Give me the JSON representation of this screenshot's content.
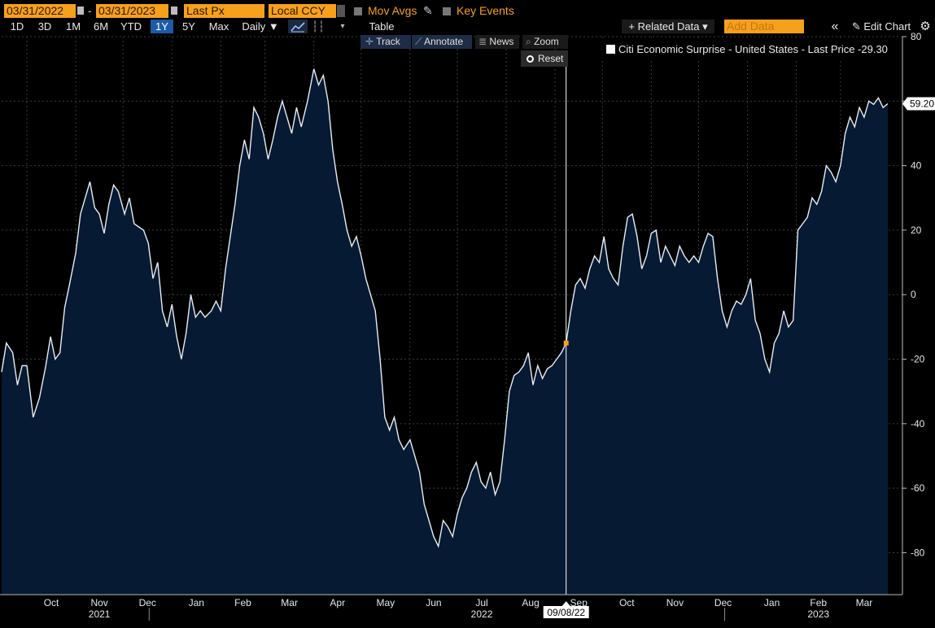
{
  "toolbar": {
    "start_date": "03/31/2022",
    "end_date": "03/31/2023",
    "date_separator": "-",
    "price_field": "Last Px",
    "currency": "Local CCY",
    "mov_avgs": "Mov Avgs",
    "key_events": "Key Events",
    "related_data": "+ Related Data ▾",
    "add_data_placeholder": "Add Data",
    "collapse": "«",
    "edit_chart": "✎ Edit Chart",
    "gear": "⚙"
  },
  "ranges": {
    "buttons": [
      "1D",
      "3D",
      "1M",
      "6M",
      "YTD",
      "1Y",
      "5Y",
      "Max"
    ],
    "active": "1Y",
    "frequency": "Daily ▼",
    "table": "Table"
  },
  "tools": {
    "track": "Track",
    "annotate": "Annotate",
    "news": "News",
    "zoom": "Zoom",
    "reset": "Reset"
  },
  "legend": {
    "label": "Citi Economic Surprise - United States - Last Price -29.30"
  },
  "crosshair": {
    "date_label": "09/08/22",
    "value": -15
  },
  "last_value_label": "59.20",
  "colors": {
    "accent": "#f7a01c",
    "area_fill": "#061a33",
    "line": "#e8eef5",
    "active_button": "#1c5ba8"
  },
  "chart_data": {
    "type": "area",
    "series_label": "Citi Economic Surprise - United States - Last Price",
    "ylim": [
      -93,
      80
    ],
    "y_ticks": [
      80,
      60,
      40,
      20,
      0,
      -20,
      -40,
      -60,
      -80
    ],
    "x_ticks": [
      {
        "label": "Oct",
        "year": ""
      },
      {
        "label": "Nov",
        "year": "2021"
      },
      {
        "label": "Dec",
        "year": ""
      },
      {
        "label": "Jan",
        "year": ""
      },
      {
        "label": "Feb",
        "year": ""
      },
      {
        "label": "Mar",
        "year": ""
      },
      {
        "label": "Apr",
        "year": ""
      },
      {
        "label": "May",
        "year": ""
      },
      {
        "label": "Jun",
        "year": ""
      },
      {
        "label": "Jul",
        "year": "2022"
      },
      {
        "label": "Aug",
        "year": ""
      },
      {
        "label": "Sep",
        "year": ""
      },
      {
        "label": "Oct",
        "year": ""
      },
      {
        "label": "Nov",
        "year": ""
      },
      {
        "label": "Dec",
        "year": ""
      },
      {
        "label": "Jan",
        "year": ""
      },
      {
        "label": "Feb",
        "year": "2023"
      },
      {
        "label": "Mar",
        "year": ""
      }
    ],
    "x_start": "2021-09-15",
    "x_end": "2023-03-31",
    "points": [
      [
        "2021-09-15",
        -24
      ],
      [
        "2021-09-18",
        -15
      ],
      [
        "2021-09-22",
        -18
      ],
      [
        "2021-09-25",
        -28
      ],
      [
        "2021-09-28",
        -22
      ],
      [
        "2021-10-01",
        -22
      ],
      [
        "2021-10-05",
        -38
      ],
      [
        "2021-10-09",
        -32
      ],
      [
        "2021-10-13",
        -22
      ],
      [
        "2021-10-16",
        -13
      ],
      [
        "2021-10-19",
        -20
      ],
      [
        "2021-10-22",
        -18
      ],
      [
        "2021-10-25",
        -4
      ],
      [
        "2021-10-28",
        3
      ],
      [
        "2021-11-01",
        13
      ],
      [
        "2021-11-04",
        25
      ],
      [
        "2021-11-07",
        30
      ],
      [
        "2021-11-10",
        35
      ],
      [
        "2021-11-13",
        27
      ],
      [
        "2021-11-16",
        25
      ],
      [
        "2021-11-19",
        19
      ],
      [
        "2021-11-22",
        28
      ],
      [
        "2021-11-25",
        34
      ],
      [
        "2021-11-28",
        32
      ],
      [
        "2021-12-02",
        25
      ],
      [
        "2021-12-05",
        30
      ],
      [
        "2021-12-08",
        22
      ],
      [
        "2021-12-11",
        21
      ],
      [
        "2021-12-14",
        20
      ],
      [
        "2021-12-17",
        16
      ],
      [
        "2021-12-20",
        5
      ],
      [
        "2021-12-23",
        10
      ],
      [
        "2021-12-26",
        -5
      ],
      [
        "2021-12-29",
        -10
      ],
      [
        "2022-01-01",
        -3
      ],
      [
        "2022-01-04",
        -13
      ],
      [
        "2022-01-07",
        -20
      ],
      [
        "2022-01-10",
        -12
      ],
      [
        "2022-01-13",
        0
      ],
      [
        "2022-01-16",
        -7
      ],
      [
        "2022-01-19",
        -5
      ],
      [
        "2022-01-22",
        -7
      ],
      [
        "2022-01-26",
        -5
      ],
      [
        "2022-01-29",
        -2
      ],
      [
        "2022-02-01",
        -5
      ],
      [
        "2022-02-04",
        8
      ],
      [
        "2022-02-07",
        18
      ],
      [
        "2022-02-10",
        28
      ],
      [
        "2022-02-13",
        40
      ],
      [
        "2022-02-16",
        48
      ],
      [
        "2022-02-19",
        42
      ],
      [
        "2022-02-22",
        58
      ],
      [
        "2022-02-25",
        55
      ],
      [
        "2022-02-28",
        50
      ],
      [
        "2022-03-03",
        42
      ],
      [
        "2022-03-06",
        48
      ],
      [
        "2022-03-09",
        55
      ],
      [
        "2022-03-12",
        60
      ],
      [
        "2022-03-15",
        55
      ],
      [
        "2022-03-18",
        50
      ],
      [
        "2022-03-21",
        58
      ],
      [
        "2022-03-24",
        52
      ],
      [
        "2022-03-28",
        60
      ],
      [
        "2022-04-01",
        70
      ],
      [
        "2022-04-04",
        65
      ],
      [
        "2022-04-07",
        68
      ],
      [
        "2022-04-10",
        60
      ],
      [
        "2022-04-13",
        45
      ],
      [
        "2022-04-16",
        35
      ],
      [
        "2022-04-19",
        28
      ],
      [
        "2022-04-22",
        20
      ],
      [
        "2022-04-25",
        15
      ],
      [
        "2022-04-28",
        18
      ],
      [
        "2022-05-01",
        12
      ],
      [
        "2022-05-04",
        5
      ],
      [
        "2022-05-07",
        0
      ],
      [
        "2022-05-10",
        -5
      ],
      [
        "2022-05-13",
        -20
      ],
      [
        "2022-05-16",
        -38
      ],
      [
        "2022-05-19",
        -42
      ],
      [
        "2022-05-22",
        -38
      ],
      [
        "2022-05-25",
        -45
      ],
      [
        "2022-05-28",
        -48
      ],
      [
        "2022-06-01",
        -45
      ],
      [
        "2022-06-04",
        -50
      ],
      [
        "2022-06-07",
        -55
      ],
      [
        "2022-06-10",
        -65
      ],
      [
        "2022-06-13",
        -70
      ],
      [
        "2022-06-16",
        -75
      ],
      [
        "2022-06-19",
        -78
      ],
      [
        "2022-06-22",
        -70
      ],
      [
        "2022-06-25",
        -72
      ],
      [
        "2022-06-28",
        -75
      ],
      [
        "2022-07-01",
        -68
      ],
      [
        "2022-07-04",
        -63
      ],
      [
        "2022-07-07",
        -60
      ],
      [
        "2022-07-10",
        -55
      ],
      [
        "2022-07-13",
        -52
      ],
      [
        "2022-07-16",
        -58
      ],
      [
        "2022-07-19",
        -60
      ],
      [
        "2022-07-22",
        -55
      ],
      [
        "2022-07-25",
        -62
      ],
      [
        "2022-07-28",
        -58
      ],
      [
        "2022-07-31",
        -45
      ],
      [
        "2022-08-03",
        -30
      ],
      [
        "2022-08-06",
        -25
      ],
      [
        "2022-08-09",
        -24
      ],
      [
        "2022-08-12",
        -22
      ],
      [
        "2022-08-15",
        -18
      ],
      [
        "2022-08-18",
        -28
      ],
      [
        "2022-08-21",
        -22
      ],
      [
        "2022-08-24",
        -26
      ],
      [
        "2022-08-27",
        -23
      ],
      [
        "2022-08-30",
        -22
      ],
      [
        "2022-09-02",
        -20
      ],
      [
        "2022-09-05",
        -18
      ],
      [
        "2022-09-08",
        -15
      ],
      [
        "2022-09-11",
        -5
      ],
      [
        "2022-09-14",
        3
      ],
      [
        "2022-09-17",
        5
      ],
      [
        "2022-09-20",
        2
      ],
      [
        "2022-09-23",
        8
      ],
      [
        "2022-09-26",
        12
      ],
      [
        "2022-09-29",
        10
      ],
      [
        "2022-10-02",
        18
      ],
      [
        "2022-10-05",
        8
      ],
      [
        "2022-10-08",
        5
      ],
      [
        "2022-10-11",
        3
      ],
      [
        "2022-10-14",
        15
      ],
      [
        "2022-10-17",
        24
      ],
      [
        "2022-10-20",
        25
      ],
      [
        "2022-10-23",
        18
      ],
      [
        "2022-10-26",
        8
      ],
      [
        "2022-10-29",
        12
      ],
      [
        "2022-11-01",
        19
      ],
      [
        "2022-11-04",
        20
      ],
      [
        "2022-11-07",
        10
      ],
      [
        "2022-11-10",
        15
      ],
      [
        "2022-11-13",
        12
      ],
      [
        "2022-11-16",
        9
      ],
      [
        "2022-11-19",
        15
      ],
      [
        "2022-11-22",
        12
      ],
      [
        "2022-11-25",
        10
      ],
      [
        "2022-11-28",
        12
      ],
      [
        "2022-12-01",
        10
      ],
      [
        "2022-12-04",
        15
      ],
      [
        "2022-12-07",
        19
      ],
      [
        "2022-12-10",
        18
      ],
      [
        "2022-12-13",
        5
      ],
      [
        "2022-12-16",
        -5
      ],
      [
        "2022-12-19",
        -10
      ],
      [
        "2022-12-22",
        -5
      ],
      [
        "2022-12-25",
        -2
      ],
      [
        "2022-12-28",
        -3
      ],
      [
        "2022-12-31",
        0
      ],
      [
        "2023-01-03",
        5
      ],
      [
        "2023-01-06",
        -8
      ],
      [
        "2023-01-09",
        -12
      ],
      [
        "2023-01-12",
        -20
      ],
      [
        "2023-01-15",
        -24
      ],
      [
        "2023-01-18",
        -15
      ],
      [
        "2023-01-21",
        -12
      ],
      [
        "2023-01-24",
        -5
      ],
      [
        "2023-01-27",
        -10
      ],
      [
        "2023-01-30",
        -8
      ],
      [
        "2023-02-02",
        20
      ],
      [
        "2023-02-05",
        22
      ],
      [
        "2023-02-08",
        24
      ],
      [
        "2023-02-11",
        30
      ],
      [
        "2023-02-14",
        28
      ],
      [
        "2023-02-17",
        32
      ],
      [
        "2023-02-20",
        40
      ],
      [
        "2023-02-23",
        38
      ],
      [
        "2023-02-26",
        35
      ],
      [
        "2023-03-01",
        40
      ],
      [
        "2023-03-04",
        50
      ],
      [
        "2023-03-07",
        55
      ],
      [
        "2023-03-10",
        52
      ],
      [
        "2023-03-13",
        58
      ],
      [
        "2023-03-16",
        55
      ],
      [
        "2023-03-19",
        60
      ],
      [
        "2023-03-22",
        59
      ],
      [
        "2023-03-25",
        61
      ],
      [
        "2023-03-28",
        58
      ],
      [
        "2023-03-31",
        59.2
      ]
    ]
  }
}
